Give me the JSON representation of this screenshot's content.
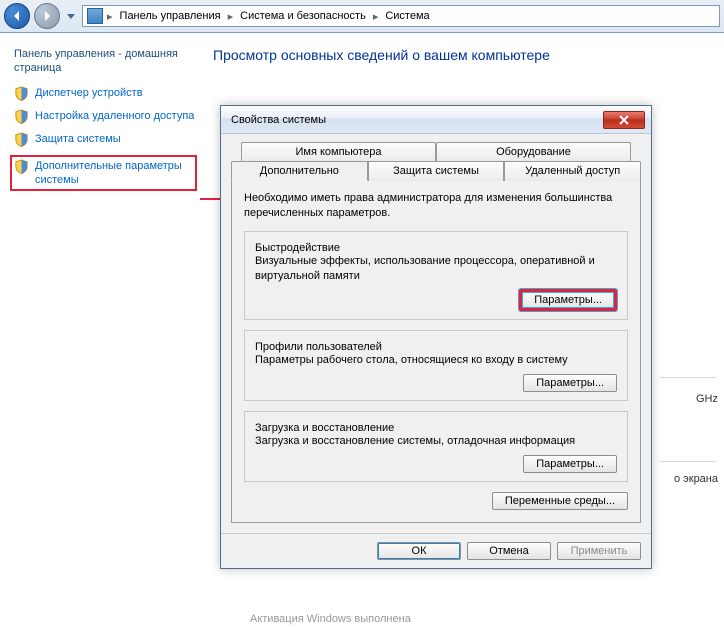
{
  "breadcrumb": {
    "root_icon": "computer",
    "items": [
      "Панель управления",
      "Система и безопасность",
      "Система"
    ]
  },
  "sidebar": {
    "heading": "Панель управления - домашняя страница",
    "links": [
      {
        "label": "Диспетчер устройств"
      },
      {
        "label": "Настройка удаленного доступа"
      },
      {
        "label": "Защита системы"
      },
      {
        "label": "Дополнительные параметры системы"
      }
    ]
  },
  "content": {
    "heading": "Просмотр основных сведений о вашем компьютере",
    "bg_ghz": "GHz",
    "bg_screen": "о экрана",
    "activation": "Активация Windows выполнена"
  },
  "dialog": {
    "title": "Свойства системы",
    "tabs_row1": [
      "Имя компьютера",
      "Оборудование"
    ],
    "tabs_row2": [
      "Дополнительно",
      "Защита системы",
      "Удаленный доступ"
    ],
    "intro": "Необходимо иметь права администратора для изменения большинства перечисленных параметров.",
    "groups": [
      {
        "legend": "Быстродействие",
        "text": "Визуальные эффекты, использование процессора, оперативной и виртуальной памяти",
        "button": "Параметры..."
      },
      {
        "legend": "Профили пользователей",
        "text": "Параметры рабочего стола, относящиеся ко входу в систему",
        "button": "Параметры..."
      },
      {
        "legend": "Загрузка и восстановление",
        "text": "Загрузка и восстановление системы, отладочная информация",
        "button": "Параметры..."
      }
    ],
    "env_button": "Переменные среды...",
    "footer": {
      "ok": "ОК",
      "cancel": "Отмена",
      "apply": "Применить"
    }
  }
}
